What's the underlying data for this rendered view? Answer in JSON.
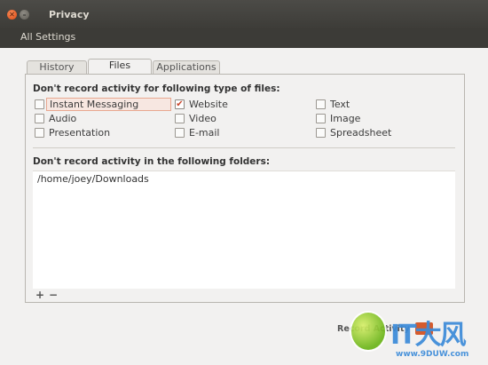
{
  "window": {
    "title": "Privacy",
    "menu": {
      "all_settings": "All Settings"
    }
  },
  "tabs": [
    {
      "label": "History",
      "active": false
    },
    {
      "label": "Files",
      "active": true
    },
    {
      "label": "Applications",
      "active": false
    }
  ],
  "files_section": {
    "title": "Don't record activity for following type of files:",
    "types": [
      {
        "label": "Instant Messaging",
        "checked": false,
        "focused": true
      },
      {
        "label": "Website",
        "checked": true
      },
      {
        "label": "Text",
        "checked": false
      },
      {
        "label": "Audio",
        "checked": false
      },
      {
        "label": "Video",
        "checked": false
      },
      {
        "label": "Image",
        "checked": false
      },
      {
        "label": "Presentation",
        "checked": false
      },
      {
        "label": "E-mail",
        "checked": false
      },
      {
        "label": "Spreadsheet",
        "checked": false
      }
    ]
  },
  "folders_section": {
    "title": "Don't record activity in the following folders:",
    "folders": [
      "/home/joey/Downloads"
    ],
    "add_label": "+",
    "remove_label": "−"
  },
  "footer": {
    "record_activity_label": "Record Activity",
    "accent": "#d55b2d"
  },
  "watermark": {
    "text": "IT大风",
    "url": "www.9DUW.com"
  },
  "icons": {
    "close": "close-icon",
    "minimize": "minimize-icon",
    "check": "checkmark-icon"
  }
}
